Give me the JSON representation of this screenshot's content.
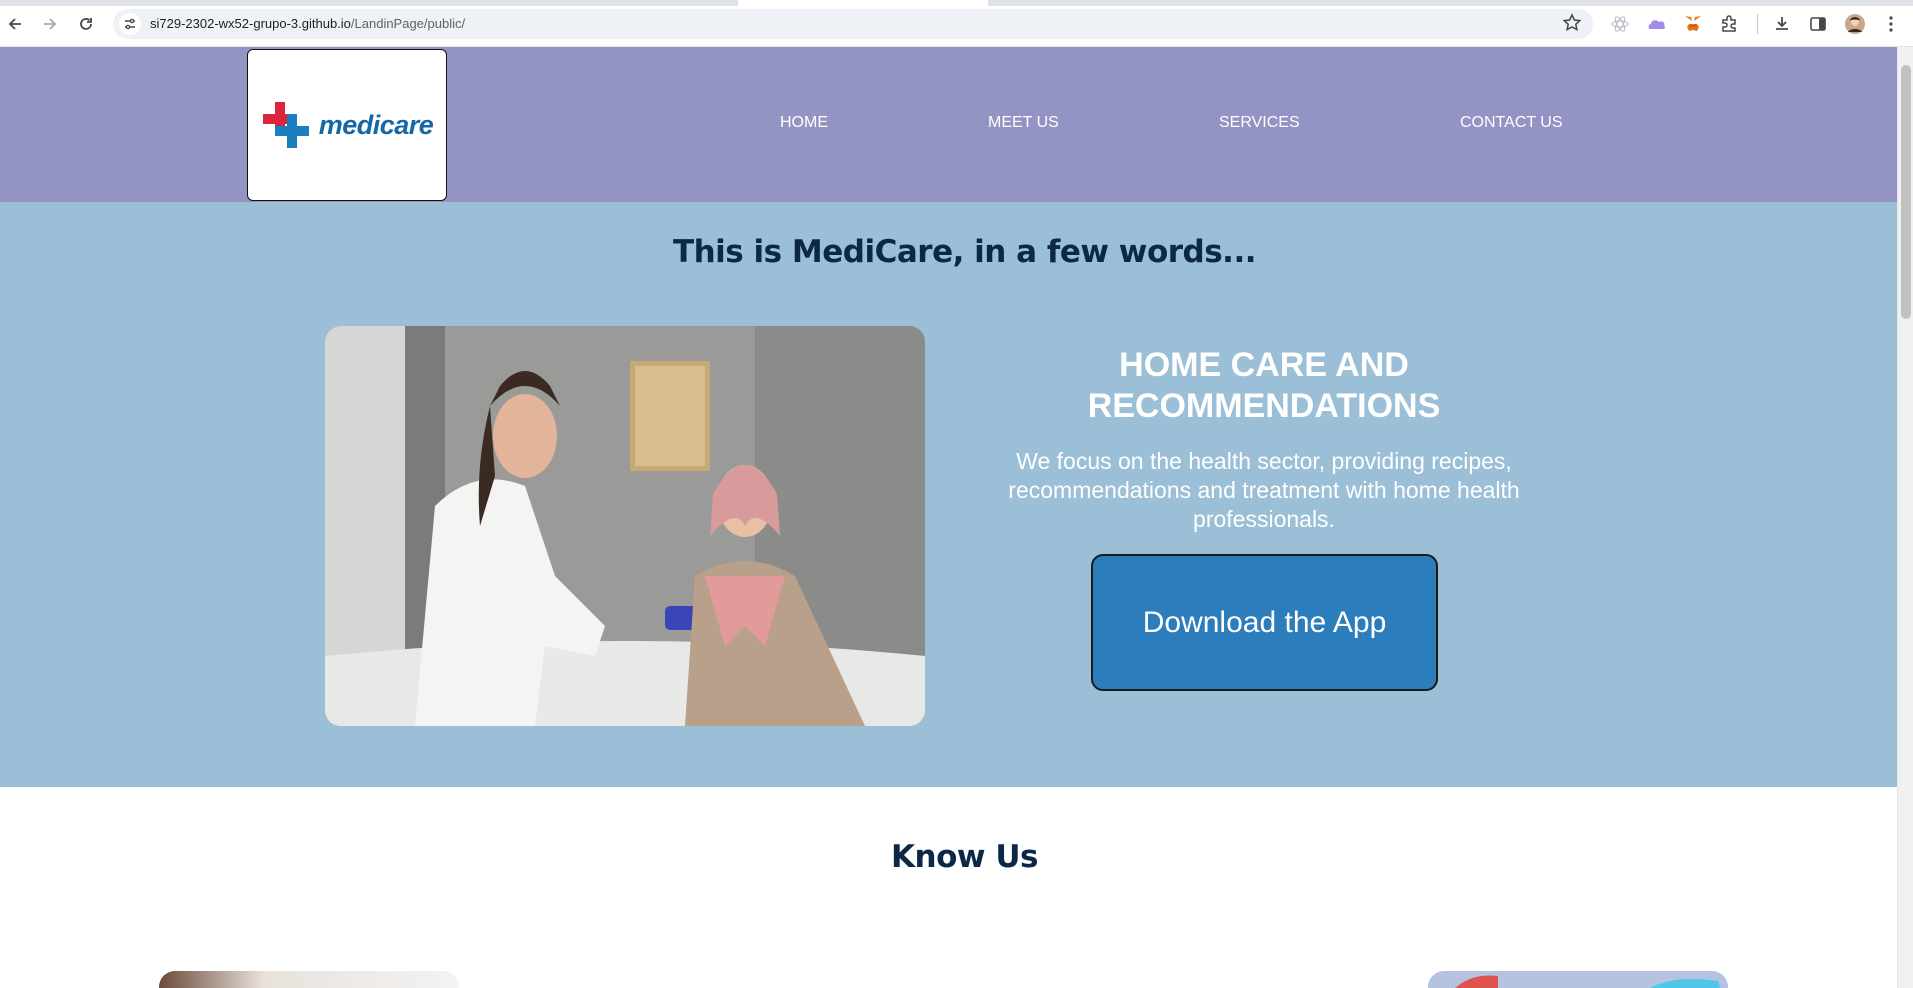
{
  "browser": {
    "url_domain": "si729-2302-wx52-grupo-3.github.io",
    "url_path": "/LandinPage/public/"
  },
  "header": {
    "logo_alt": "medicare",
    "nav": [
      {
        "label": "HOME"
      },
      {
        "label": "MEET US"
      },
      {
        "label": "SERVICES"
      },
      {
        "label": "CONTACT US"
      }
    ]
  },
  "hero": {
    "title": "This is MediCare, in a few words...",
    "heading": "HOME CARE AND RECOMMENDATIONS",
    "text": "We focus on the health sector, providing recipes, recommendations and treatment with home health professionals.",
    "button_label": "Download the App"
  },
  "know_us": {
    "title": "Know Us"
  },
  "colors": {
    "header_bg": "#9394c4",
    "hero_bg": "#9bbfd6",
    "button_bg": "#2b7dbb",
    "title_text": "#0d2747"
  }
}
